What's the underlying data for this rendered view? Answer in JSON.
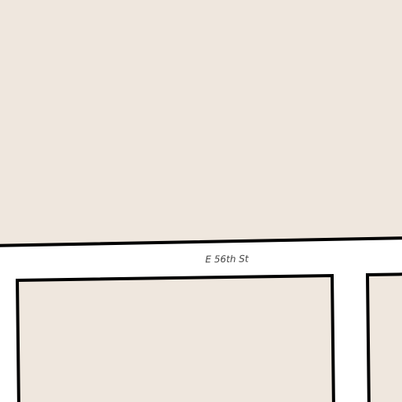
{
  "map": {
    "colors": {
      "block_fill": "#efe7de",
      "block_outline": "#000000",
      "road": "#ffffff",
      "label": "#444444"
    },
    "streets": [
      {
        "name": "E 56th St"
      }
    ]
  }
}
